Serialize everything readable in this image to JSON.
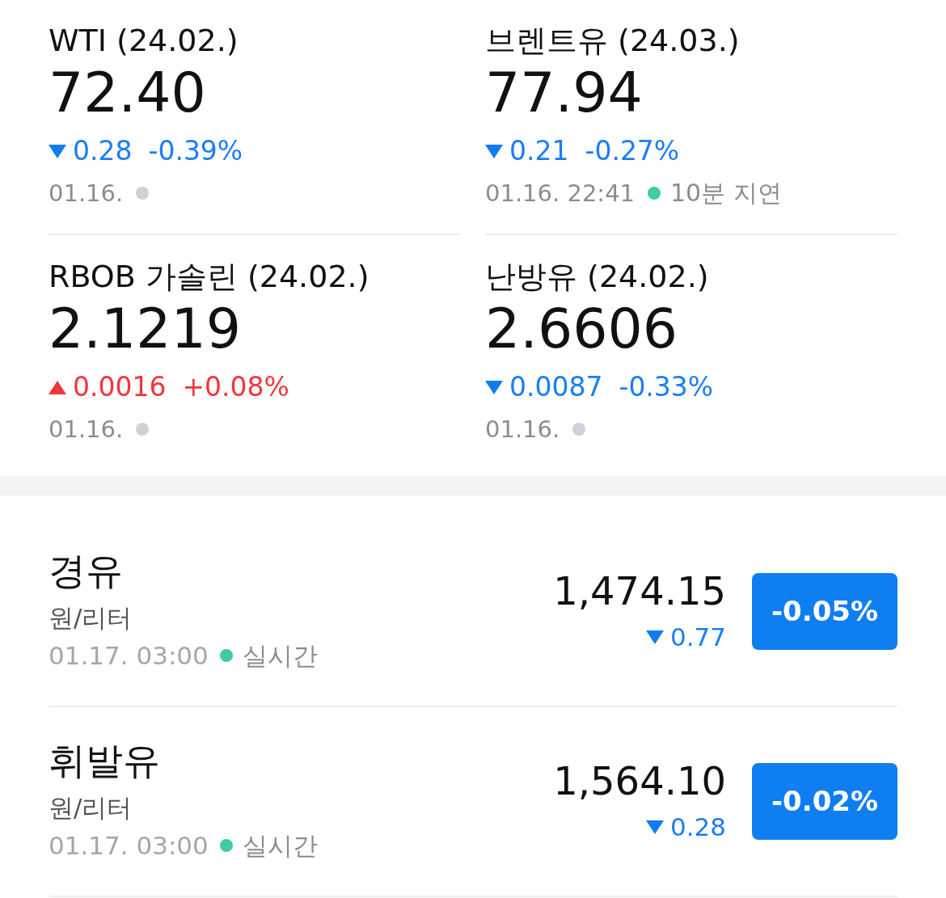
{
  "futures": [
    {
      "name": "WTI (24.02.)",
      "price": "72.40",
      "kind": "down",
      "change": "0.28",
      "percent": "-0.39%",
      "date": "01.16.",
      "color": "#cdd1d9"
    },
    {
      "name": "브렌트유 (24.03.)",
      "price": "77.94",
      "kind": "down",
      "change": "0.21",
      "percent": "-0.27%",
      "date": "01.16. 22:41",
      "color": "#3fcca6",
      "status": "10분 지연"
    },
    {
      "name": "RBOB 가솔린 (24.02.)",
      "price": "2.1219",
      "kind": "up",
      "change": "0.0016",
      "percent": "+0.08%",
      "date": "01.16.",
      "color": "#cdd1d9"
    },
    {
      "name": "난방유 (24.02.)",
      "price": "2.6606",
      "kind": "down",
      "change": "0.0087",
      "percent": "-0.33%",
      "date": "01.16.",
      "color": "#cdd1d9"
    }
  ],
  "domestic": [
    {
      "name": "경유",
      "unit": "원/리터",
      "date": "01.17. 03:00",
      "color": "#3fcca6",
      "status": "실시간",
      "price": "1,474.15",
      "kind": "down",
      "change": "0.77",
      "percent": "-0.05%"
    },
    {
      "name": "휘발유",
      "unit": "원/리터",
      "date": "01.17. 03:00",
      "color": "#3fcca6",
      "status": "실시간",
      "price": "1,564.10",
      "kind": "down",
      "change": "0.28",
      "percent": "-0.02%"
    }
  ]
}
